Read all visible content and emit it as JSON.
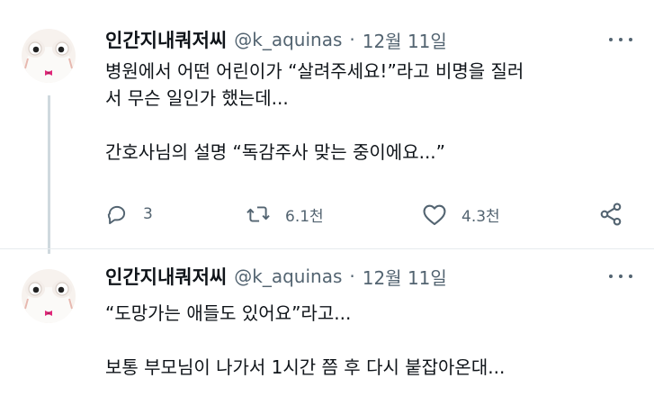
{
  "tweets": [
    {
      "author": {
        "display_name": "인간지내쿼저씨",
        "handle": "@k_aquinas",
        "separator": "·",
        "date": "12월 11일"
      },
      "lines": [
        "병원에서 어떤 어린이가 “살려주세요!”라고 비명을 질러",
        "서 무슨 일인가 했는데...",
        "",
        "간호사님의 설명 “독감주사 맞는 중이에요...”"
      ],
      "actions": {
        "reply_count": "3",
        "retweet_count": "6.1천",
        "like_count": "4.3천"
      }
    },
    {
      "author": {
        "display_name": "인간지내쿼저씨",
        "handle": "@k_aquinas",
        "separator": "·",
        "date": "12월 11일"
      },
      "lines": [
        "“도망가는 애들도 있어요”라고...",
        "",
        "보통 부모님이 나가서 1시간 쯤 후 다시 붙잡아온대..."
      ]
    }
  ],
  "icons": {
    "reply": "reply-icon",
    "retweet": "retweet-icon",
    "like": "heart-icon",
    "share": "share-icon",
    "more": "more-icon",
    "avatar": "frog-avatar"
  },
  "colors": {
    "text": "#0f1419",
    "secondary": "#536471",
    "thread_line": "#cfd9de",
    "bow_tie": "#e0287a"
  }
}
